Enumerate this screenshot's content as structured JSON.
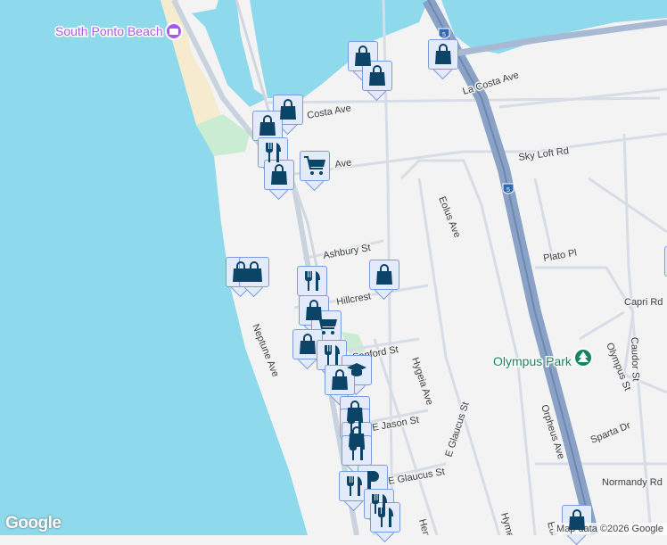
{
  "map": {
    "pois": {
      "beach": "South Ponto Beach",
      "park": "Olympus Park"
    },
    "streets": {
      "la_costa_1": "La Costa Ave",
      "la_costa_2": "Costa Ave",
      "ave_partial": "Ave",
      "sky_loft": "Sky Loft Rd",
      "eolus": "Eolus Ave",
      "ashbury": "Ashbury St",
      "plato": "Plato Pl",
      "capri": "Capri Rd",
      "hillcrest": "Hillcrest",
      "neptune": "Neptune Ave",
      "sanford": "Sanford St",
      "hygeia": "Hygeia Ave",
      "olympus": "Olympus St",
      "caudor": "Caudor St",
      "jason": "E Jason St",
      "glaucus1": "E Glaucus St",
      "glaucus2": "E Glaucus St",
      "orpheus": "Orpheus Ave",
      "sparta": "Sparta Dr",
      "normandy": "Normandy Rd",
      "hymettus": "Hyme",
      "hermes": "Herm",
      "eolus2": "Eol"
    },
    "shields": {
      "i5_top": "5",
      "i5_mid": "5"
    },
    "colors": {
      "water": "#8ed9ec",
      "land": "#f4f3f4",
      "park": "#c9ecd3",
      "sand": "#f6ebcf",
      "highway": "#8aa2c6",
      "marker_icon": "#0b4466",
      "poi_beach": "#a35ae8",
      "poi_park": "#13875b"
    }
  },
  "footer": {
    "logo": "Google",
    "attribution": "Map data ©2026 Google"
  }
}
